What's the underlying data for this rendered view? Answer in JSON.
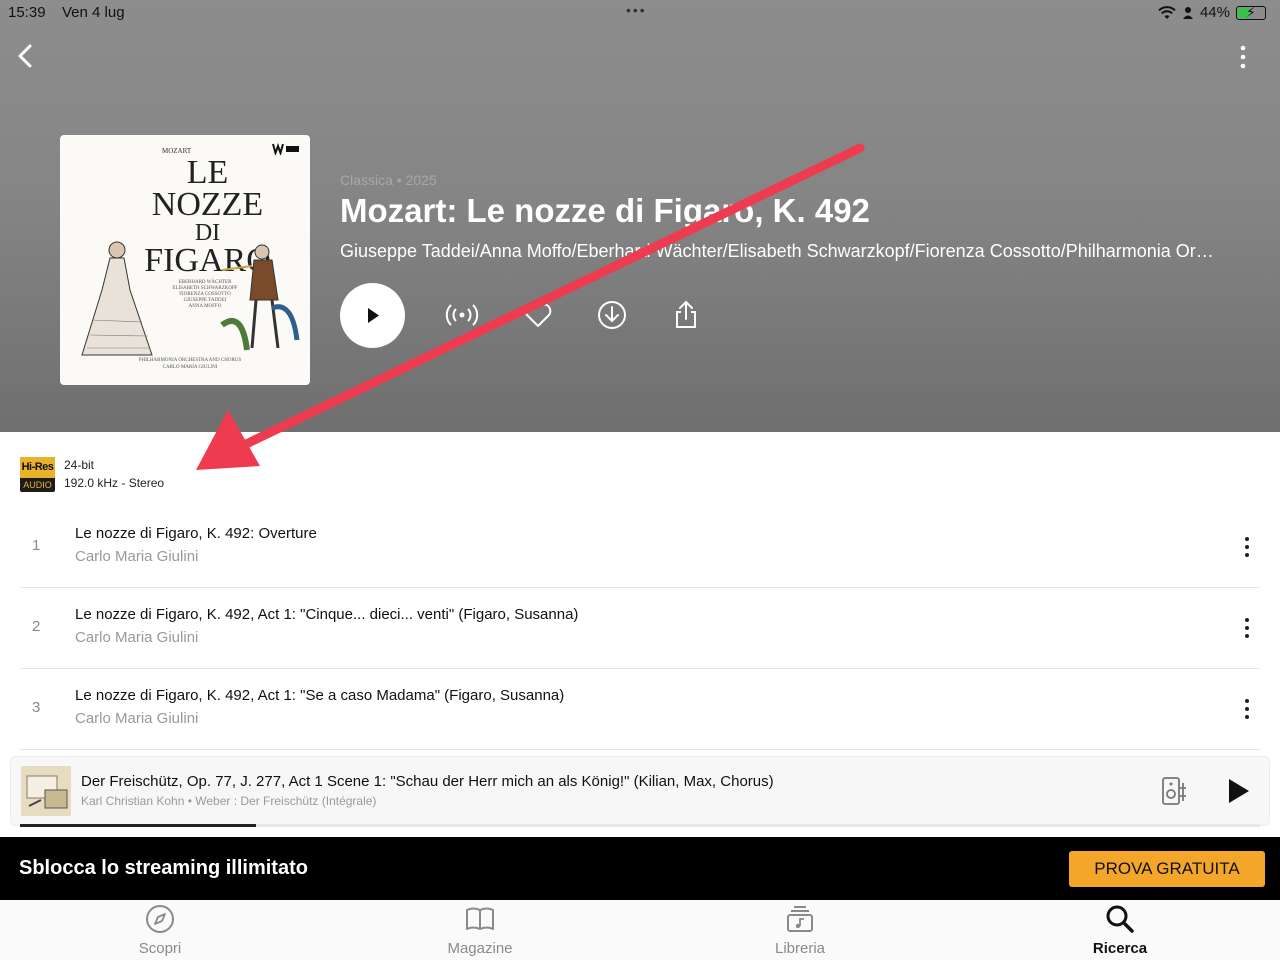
{
  "status_bar": {
    "time": "15:39",
    "date": "Ven 4 lug",
    "battery": "44%"
  },
  "album": {
    "genre_year": "Classica • 2025",
    "title": "Mozart: Le nozze di Figaro, K. 492",
    "artists": "Giuseppe Taddei/Anna Moffo/Eberhard Wächter/Elisabeth Schwarzkopf/Fiorenza Cossotto/Philharmonia Orchestra/Carlo Maria Giulini",
    "cover": {
      "composer": "MOZART",
      "title_lines": [
        "LE",
        "NOZZE",
        "DI",
        "FIGARO"
      ],
      "cast": [
        "EBERHARD WÄCHTER",
        "ELISABETH SCHWARZKOPF",
        "FIORENZA COSSOTTO",
        "GIUSEPPE TADDEI",
        "ANNA MOFFO"
      ],
      "orchestra": "PHILHARMONIA ORCHESTRA AND CHORUS",
      "conductor": "CARLO MARIA GIULINI"
    }
  },
  "quality": {
    "badge_top": "Hi-Res",
    "badge_bottom": "AUDIO",
    "bit_depth": "24-bit",
    "rate": "192.0 kHz - Stereo"
  },
  "tracks": [
    {
      "num": "1",
      "title": "Le nozze di Figaro, K. 492: Overture",
      "artist": "Carlo Maria Giulini"
    },
    {
      "num": "2",
      "title": "Le nozze di Figaro, K. 492, Act 1: \"Cinque... dieci... venti\" (Figaro, Susanna)",
      "artist": "Carlo Maria Giulini"
    },
    {
      "num": "3",
      "title": "Le nozze di Figaro, K. 492, Act 1: \"Se a caso Madama\" (Figaro, Susanna)",
      "artist": "Carlo Maria Giulini"
    }
  ],
  "now_playing": {
    "title": "Der Freischütz, Op. 77, J. 277, Act 1 Scene 1: \"Schau der Herr mich an als König!\" (Kilian, Max, Chorus)",
    "subtitle": "Karl Christian Kohn • Weber : Der Freischütz (Intégrale)",
    "progress": 0.19
  },
  "promo": {
    "text": "Sblocca lo streaming illimitato",
    "button": "PROVA GRATUITA"
  },
  "tabs": [
    {
      "label": "Scopri",
      "icon": "compass-icon"
    },
    {
      "label": "Magazine",
      "icon": "book-icon"
    },
    {
      "label": "Libreria",
      "icon": "library-icon"
    },
    {
      "label": "Ricerca",
      "icon": "search-icon",
      "active": true
    }
  ],
  "colors": {
    "accent": "#f4a62a",
    "annotation_arrow": "#ee3b4f",
    "header_gray": "#858585"
  }
}
